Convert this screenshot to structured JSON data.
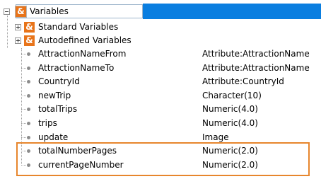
{
  "root": {
    "label": "Variables",
    "icon": "ampersand-icon"
  },
  "groups": [
    {
      "label": "Standard Variables",
      "icon": "ampersand-icon"
    },
    {
      "label": "Autodefined Variables",
      "icon": "ampersand-icon"
    }
  ],
  "variables": [
    {
      "name": "AttractionNameFrom",
      "type": "Attribute:AttractionName"
    },
    {
      "name": "AttractionNameTo",
      "type": "Attribute:AttractionName"
    },
    {
      "name": "CountryId",
      "type": "Attribute:CountryId"
    },
    {
      "name": "newTrip",
      "type": "Character(10)"
    },
    {
      "name": "totalTrips",
      "type": "Numeric(4.0)"
    },
    {
      "name": "trips",
      "type": "Numeric(4.0)"
    },
    {
      "name": "update",
      "type": "Image"
    },
    {
      "name": "totalNumberPages",
      "type": "Numeric(2.0)"
    },
    {
      "name": "currentPageNumber",
      "type": "Numeric(2.0)"
    }
  ],
  "colors": {
    "selection_blue": "#0a7ee0",
    "amp_orange": "#e8741a",
    "highlight_orange": "#e7862d"
  }
}
